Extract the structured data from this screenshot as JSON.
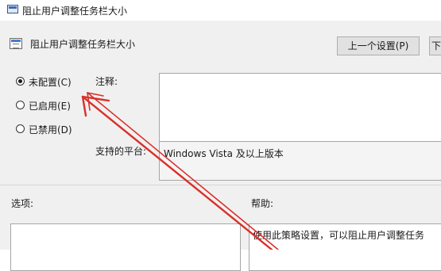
{
  "window": {
    "title": "阻止用户调整任务栏大小"
  },
  "header": {
    "policy_name": "阻止用户调整任务栏大小",
    "prev_button": "上一个设置(P)",
    "next_button": "下"
  },
  "state": {
    "options": [
      {
        "label": "未配置(C)",
        "checked": true
      },
      {
        "label": "已启用(E)",
        "checked": false
      },
      {
        "label": "已禁用(D)",
        "checked": false
      }
    ]
  },
  "comment": {
    "label": "注释:",
    "value": ""
  },
  "supported": {
    "label": "支持的平台:",
    "value": "Windows Vista 及以上版本"
  },
  "options_panel": {
    "label": "选项:"
  },
  "help_panel": {
    "label": "帮助:",
    "text": "使用此策略设置，可以阻止用户调整任务"
  },
  "annotation": {
    "arrow_color": "#d9302a"
  }
}
